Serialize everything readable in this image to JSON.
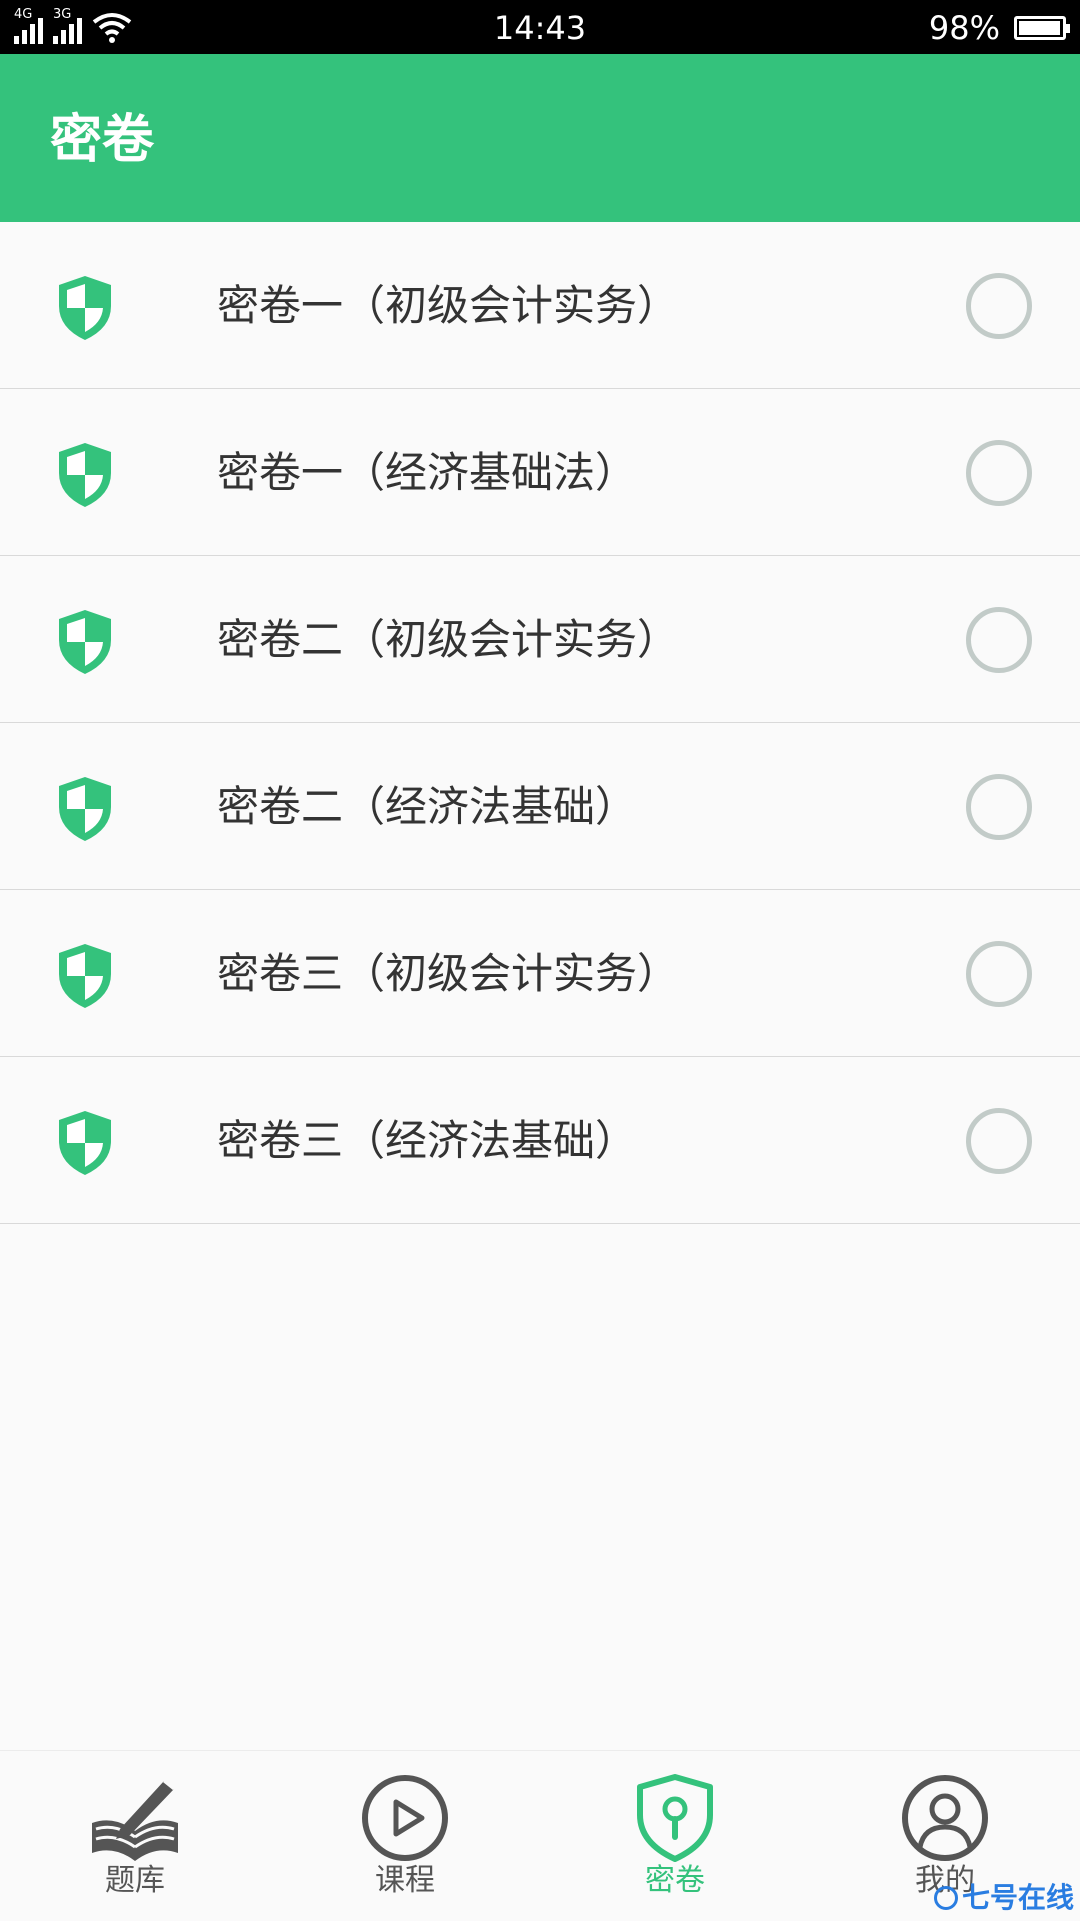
{
  "status_bar": {
    "network_1": "4G",
    "network_2": "3G",
    "time": "14:43",
    "battery_percent": "98%",
    "battery_level": 0.98
  },
  "app_bar": {
    "title": "密卷"
  },
  "list": {
    "items": [
      {
        "label": "密卷一（初级会计实务）",
        "selected": false
      },
      {
        "label": "密卷一（经济基础法）",
        "selected": false
      },
      {
        "label": "密卷二（初级会计实务）",
        "selected": false
      },
      {
        "label": "密卷二（经济法基础）",
        "selected": false
      },
      {
        "label": "密卷三（初级会计实务）",
        "selected": false
      },
      {
        "label": "密卷三（经济法基础）",
        "selected": false
      }
    ]
  },
  "tab_bar": {
    "tabs": [
      {
        "label": "题库",
        "icon": "book-pen-icon",
        "active": false
      },
      {
        "label": "课程",
        "icon": "play-icon",
        "active": false
      },
      {
        "label": "密卷",
        "icon": "shield-keyhole-icon",
        "active": true
      },
      {
        "label": "我的",
        "icon": "user-icon",
        "active": false
      }
    ]
  },
  "watermark": {
    "text": "七号在线"
  },
  "colors": {
    "accent": "#34c27c",
    "radio_border": "#c2cbc8",
    "text": "#333333",
    "tab_inactive": "#555555"
  }
}
